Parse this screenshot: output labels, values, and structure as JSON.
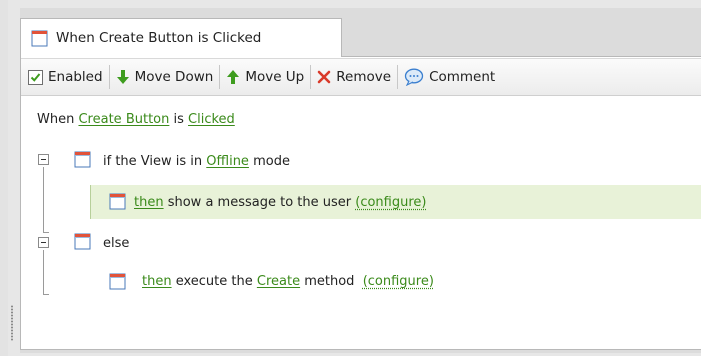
{
  "tab": {
    "title": "When Create Button is Clicked"
  },
  "toolbar": {
    "enabled_label": "Enabled",
    "move_down_label": "Move Down",
    "move_up_label": "Move Up",
    "remove_label": "Remove",
    "comment_label": "Comment"
  },
  "rule": {
    "header_prefix": "When",
    "header_control": "Create Button",
    "header_mid": "is",
    "header_event": "Clicked",
    "cond_prefix": "if the View is in",
    "cond_value": "Offline",
    "cond_suffix": "mode",
    "then1_keyword": "then",
    "then1_text": "show a message to the user",
    "then1_configure": "(configure)",
    "else_label": "else",
    "then2_keyword": "then",
    "then2_text": "execute the",
    "then2_method": "Create",
    "then2_suffix": "method",
    "then2_configure": "(configure)"
  },
  "colors": {
    "link": "#3a8a1a",
    "highlight": "#e8f2d8",
    "arrow_green": "#3e9c1e",
    "remove_red": "#d93a2a",
    "comment_blue": "#3b7fcf"
  }
}
